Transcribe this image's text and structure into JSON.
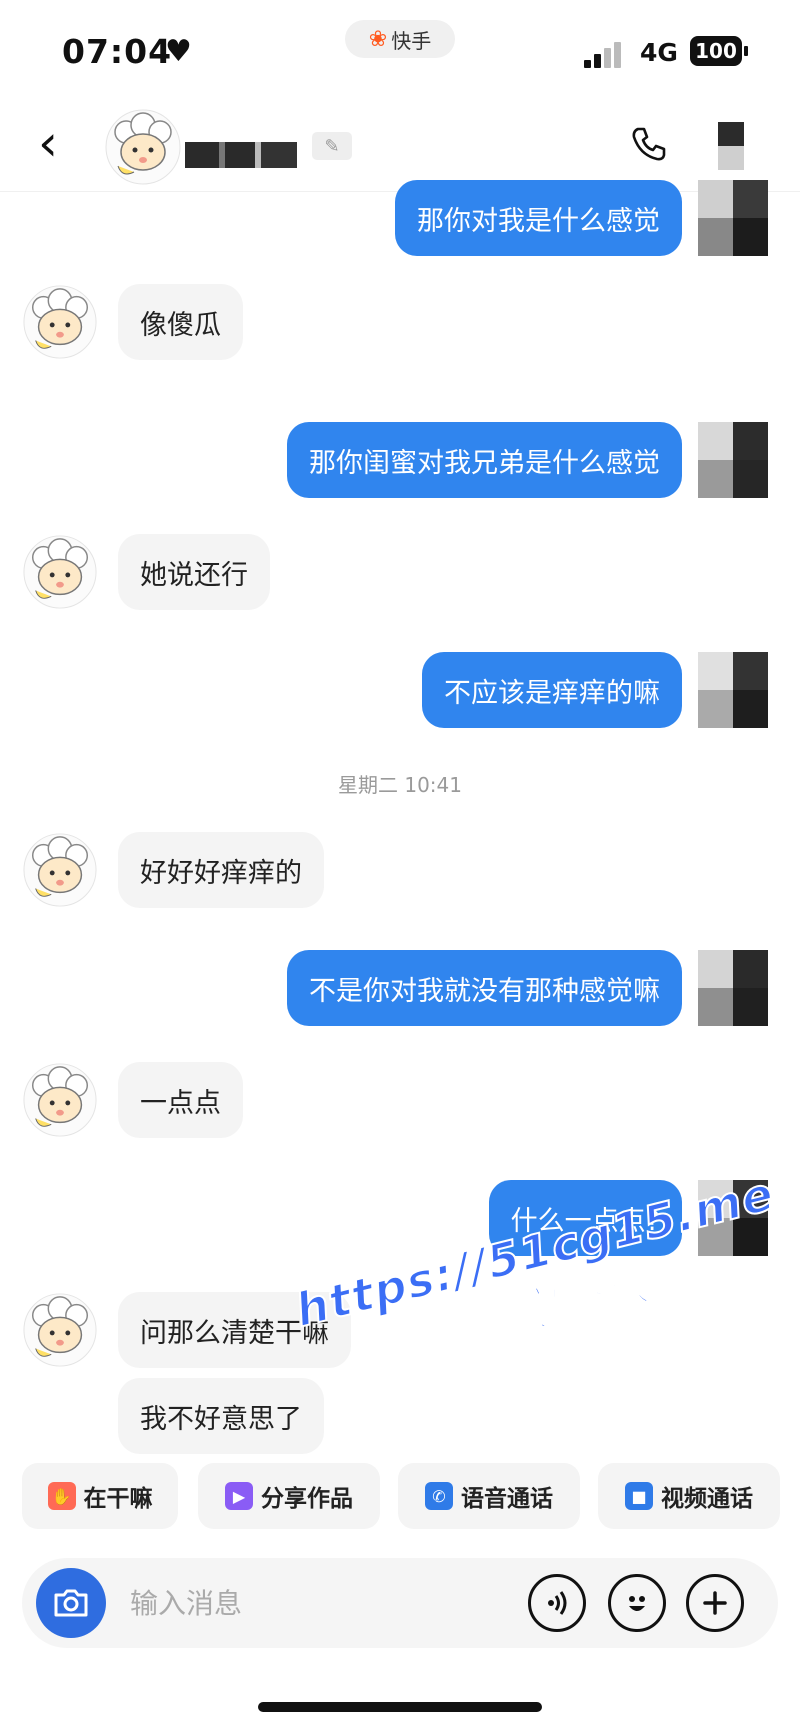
{
  "status_bar": {
    "time": "07:04",
    "heart_icon": "heart-icon",
    "app_name": "快手",
    "network": "4G",
    "battery": "100"
  },
  "header": {
    "back_icon": "chevron-left-icon",
    "phone_icon": "phone-icon"
  },
  "messages": [
    {
      "side": "out",
      "text": "那你对我是什么感觉"
    },
    {
      "side": "in",
      "text": "像傻瓜"
    },
    {
      "side": "out",
      "text": "那你闺蜜对我兄弟是什么感觉"
    },
    {
      "side": "in",
      "text": "她说还行"
    },
    {
      "side": "out",
      "text": "不应该是痒痒的嘛"
    },
    {
      "side": "in",
      "text": "好好好痒痒的"
    },
    {
      "side": "out",
      "text": "不是你对我就没有那种感觉嘛"
    },
    {
      "side": "in",
      "text": "一点点"
    },
    {
      "side": "out",
      "text": "什么一点点?"
    },
    {
      "side": "in",
      "text": "问那么清楚干嘛"
    },
    {
      "side": "in",
      "text": "我不好意思了"
    }
  ],
  "timestamp": "星期二 10:41",
  "watermark": {
    "line1": "https://51cg15.me",
    "line2": "看完整版",
    "color": "#3b6ef5"
  },
  "quick_actions": [
    {
      "label": "在干嘛",
      "icon": "wave-hand-icon",
      "color": "#ff5a4a"
    },
    {
      "label": "分享作品",
      "icon": "video-play-icon",
      "color": "#8a5cf5"
    },
    {
      "label": "语音通话",
      "icon": "phone-icon",
      "color": "#2f7be8"
    },
    {
      "label": "视频通话",
      "icon": "video-camera-icon",
      "color": "#2f7be8"
    }
  ],
  "input_bar": {
    "placeholder": "输入消息",
    "camera_icon": "camera-icon",
    "voice_icon": "voice-icon",
    "emoji_icon": "emoji-icon",
    "plus_icon": "plus-icon"
  },
  "colors": {
    "outgoing_bubble": "#3085ee",
    "incoming_bubble": "#f4f4f4"
  }
}
